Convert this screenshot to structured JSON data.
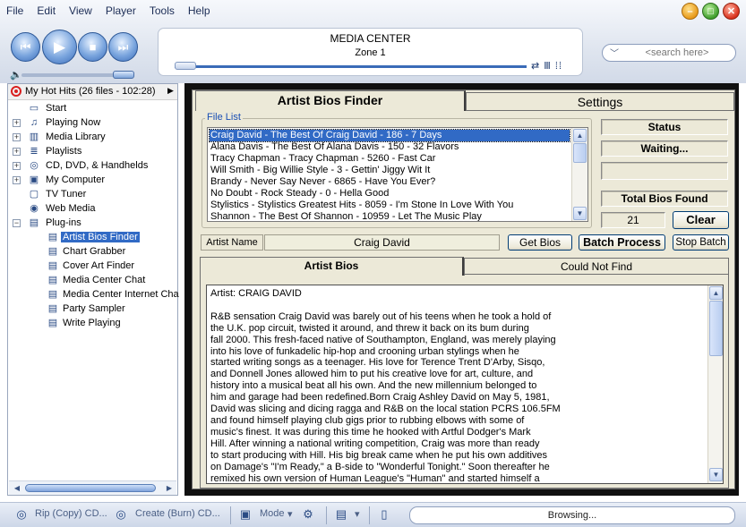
{
  "menu": [
    "File",
    "Edit",
    "View",
    "Player",
    "Tools",
    "Help"
  ],
  "transport": {
    "prev_glyph": "⏮",
    "play_glyph": "▶",
    "stop_glyph": "■",
    "next_glyph": "⏭",
    "volume_glyph": "🔈"
  },
  "window_glyphs": {
    "min": "–",
    "max": "□",
    "close": "✕"
  },
  "display": {
    "title": "MEDIA CENTER",
    "zone": "Zone 1",
    "icons": "⇄ Ⅲ ⁞⁞",
    "seek_position": 0
  },
  "search": {
    "placeholder": "<search here>",
    "chevron": "﹀"
  },
  "playlist": {
    "label": "My Hot Hits (26 files - 102:28)",
    "arrow": "▶"
  },
  "tree": [
    {
      "label": "Start",
      "icon": "start-icon",
      "glyph": "▭",
      "level": 1,
      "expander": ""
    },
    {
      "label": "Playing Now",
      "icon": "playing-now-icon",
      "glyph": "♫",
      "level": 1,
      "expander": "+"
    },
    {
      "label": "Media Library",
      "icon": "media-library-icon",
      "glyph": "▥",
      "level": 1,
      "expander": "+"
    },
    {
      "label": "Playlists",
      "icon": "playlists-icon",
      "glyph": "≣",
      "level": 1,
      "expander": "+"
    },
    {
      "label": "CD, DVD, & Handhelds",
      "icon": "cd-dvd-icon",
      "glyph": "◎",
      "level": 1,
      "expander": "+"
    },
    {
      "label": "My Computer",
      "icon": "my-computer-icon",
      "glyph": "▣",
      "level": 1,
      "expander": "+"
    },
    {
      "label": "TV Tuner",
      "icon": "tv-tuner-icon",
      "glyph": "▢",
      "level": 1,
      "expander": ""
    },
    {
      "label": "Web Media",
      "icon": "web-media-icon",
      "glyph": "◉",
      "level": 1,
      "expander": ""
    },
    {
      "label": "Plug-ins",
      "icon": "plugins-icon",
      "glyph": "▤",
      "level": 1,
      "expander": "−"
    },
    {
      "label": "Artist Bios Finder",
      "icon": "plugin-icon",
      "glyph": "▤",
      "level": 2,
      "expander": "",
      "selected": true
    },
    {
      "label": "Chart Grabber",
      "icon": "plugin-icon",
      "glyph": "▤",
      "level": 2,
      "expander": ""
    },
    {
      "label": "Cover Art Finder",
      "icon": "plugin-icon",
      "glyph": "▤",
      "level": 2,
      "expander": ""
    },
    {
      "label": "Media Center Chat",
      "icon": "plugin-icon",
      "glyph": "▤",
      "level": 2,
      "expander": ""
    },
    {
      "label": "Media Center Internet Cha",
      "icon": "plugin-icon",
      "glyph": "▤",
      "level": 2,
      "expander": ""
    },
    {
      "label": "Party Sampler",
      "icon": "plugin-icon",
      "glyph": "▤",
      "level": 2,
      "expander": ""
    },
    {
      "label": "Write Playing",
      "icon": "plugin-icon",
      "glyph": "▤",
      "level": 2,
      "expander": ""
    }
  ],
  "scroll_glyphs": {
    "left": "◀",
    "right": "▶",
    "up": "▲",
    "down": "▼"
  },
  "plugin": {
    "tabs": {
      "finder": "Artist Bios Finder",
      "settings": "Settings"
    },
    "file_list_label": "File List",
    "files": [
      {
        "text": "Craig David - The Best Of Craig David - 186 - 7 Days",
        "selected": true
      },
      {
        "text": "Alana Davis - The Best Of Alana Davis - 150 - 32 Flavors"
      },
      {
        "text": "Tracy Chapman - Tracy Chapman - 5260 - Fast Car"
      },
      {
        "text": "Will Smith - Big Willie Style - 3 - Gettin' Jiggy Wit It"
      },
      {
        "text": "Brandy - Never Say Never - 6865 - Have You Ever?"
      },
      {
        "text": "No Doubt - Rock Steady - 0 - Hella Good"
      },
      {
        "text": "Stylistics - Stylistics Greatest Hits - 8059 - I'm Stone In Love With You"
      },
      {
        "text": "Shannon - The Best Of Shannon - 10959 - Let The Music Play"
      }
    ],
    "status_label": "Status",
    "status_value": "Waiting...",
    "status_extra": "",
    "total_label": "Total Bios Found",
    "total_value": "21",
    "clear_label": "Clear",
    "artist_name_label": "Artist Name",
    "artist_name_value": "Craig David",
    "get_bios_label": "Get Bios",
    "batch_label": "Batch Process",
    "stop_batch_label": "Stop Batch",
    "bio_tabs": {
      "artist_bios": "Artist Bios",
      "not_found": "Could Not Find"
    },
    "bio_text": "Artist: CRAIG DAVID\n\nR&B sensation Craig David was barely out of his teens when he took a hold of\nthe U.K. pop circuit, twisted it around, and threw it back on its bum during\nfall 2000. This fresh-faced native of Southampton, England, was merely playing\ninto his love of funkadelic hip-hop and crooning urban stylings when he\nstarted writing songs as a teenager. His love for Terence Trent D'Arby, Sisqo,\nand Donnell Jones allowed him to put his creative love for art, culture, and\nhistory into a musical beat all his own. And the new millennium belonged to\nhim and garage had been redefined.Born Craig Ashley David on May 5, 1981,\nDavid was slicing and dicing ragga and R&B on the local station PCRS 106.5FM\nand found himself playing club gigs prior to rubbing elbows with some of\nmusic's finest. It was during this time he hooked with Artful Dodger's Mark\nHill. After winning a national writing competition, Craig was more than ready\nto start producing with Hill. His big break came when he put his own additives\non Damage's \"I'm Ready,\" a B-side to \"Wonderful Tonight.\" Soon thereafter he\nremixed his own version of Human League's \"Human\" and started himself a"
  },
  "taskbar": {
    "rip_label": "Rip (Copy) CD...",
    "burn_label": "Create (Burn) CD...",
    "mode_label": "Mode",
    "dropdown_glyph": "▾",
    "status": "Browsing..."
  },
  "colors": {
    "accent": "#316ac5",
    "chrome": "#dfe5ef",
    "panel": "#ece9d8",
    "frame": "#101010"
  }
}
